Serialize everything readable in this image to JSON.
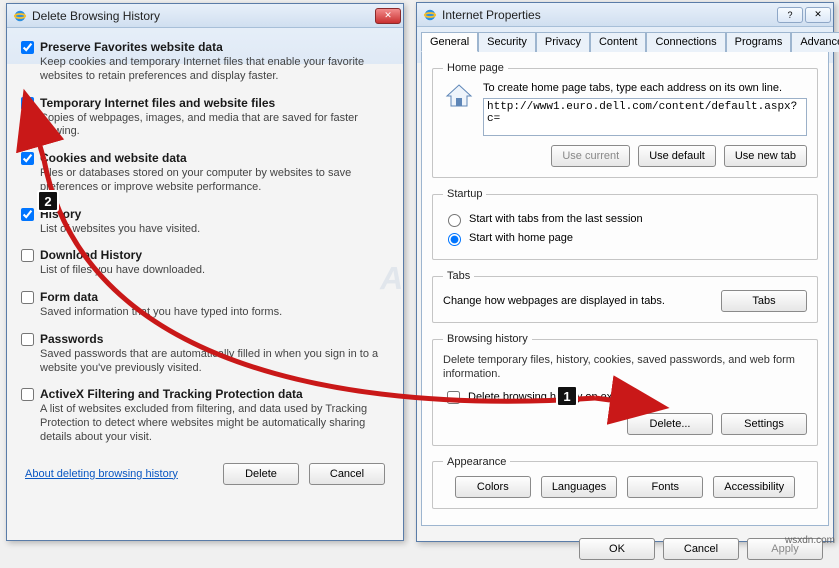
{
  "delete_dialog": {
    "title": "Delete Browsing History",
    "items": [
      {
        "checked": true,
        "label": "Preserve Favorites website data",
        "desc": "Keep cookies and temporary Internet files that enable your favorite websites to retain preferences and display faster."
      },
      {
        "checked": true,
        "label": "Temporary Internet files and website files",
        "desc": "Copies of webpages, images, and media that are saved for faster viewing."
      },
      {
        "checked": true,
        "label": "Cookies and website data",
        "desc": "Files or databases stored on your computer by websites to save preferences or improve website performance."
      },
      {
        "checked": true,
        "label": "History",
        "desc": "List of websites you have visited."
      },
      {
        "checked": false,
        "label": "Download History",
        "desc": "List of files you have downloaded."
      },
      {
        "checked": false,
        "label": "Form data",
        "desc": "Saved information that you have typed into forms."
      },
      {
        "checked": false,
        "label": "Passwords",
        "desc": "Saved passwords that are automatically filled in when you sign in to a website you've previously visited."
      },
      {
        "checked": false,
        "label": "ActiveX Filtering and Tracking Protection data",
        "desc": "A list of websites excluded from filtering, and data used by Tracking Protection to detect where websites might be automatically sharing details about your visit."
      }
    ],
    "link": "About deleting browsing history",
    "delete_btn": "Delete",
    "cancel_btn": "Cancel"
  },
  "inet_props": {
    "title": "Internet Properties",
    "tabs": [
      "General",
      "Security",
      "Privacy",
      "Content",
      "Connections",
      "Programs",
      "Advanced"
    ],
    "homepage": {
      "legend": "Home page",
      "hint": "To create home page tabs, type each address on its own line.",
      "url": "http://www1.euro.dell.com/content/default.aspx?c=",
      "use_current": "Use current",
      "use_default": "Use default",
      "use_new_tab": "Use new tab"
    },
    "startup": {
      "legend": "Startup",
      "opt1": "Start with tabs from the last session",
      "opt2": "Start with home page"
    },
    "tabs_group": {
      "legend": "Tabs",
      "desc": "Change how webpages are displayed in tabs.",
      "btn": "Tabs"
    },
    "browsing_history": {
      "legend": "Browsing history",
      "desc": "Delete temporary files, history, cookies, saved passwords, and web form information.",
      "chk_label": "Delete browsing history on exit",
      "delete_btn": "Delete...",
      "settings_btn": "Settings"
    },
    "appearance": {
      "legend": "Appearance",
      "colors": "Colors",
      "languages": "Languages",
      "fonts": "Fonts",
      "accessibility": "Accessibility"
    },
    "footer": {
      "ok": "OK",
      "cancel": "Cancel",
      "apply": "Apply"
    }
  },
  "annotations": {
    "b1": "1",
    "b2": "2"
  },
  "page_corner": "wsxdn.com"
}
